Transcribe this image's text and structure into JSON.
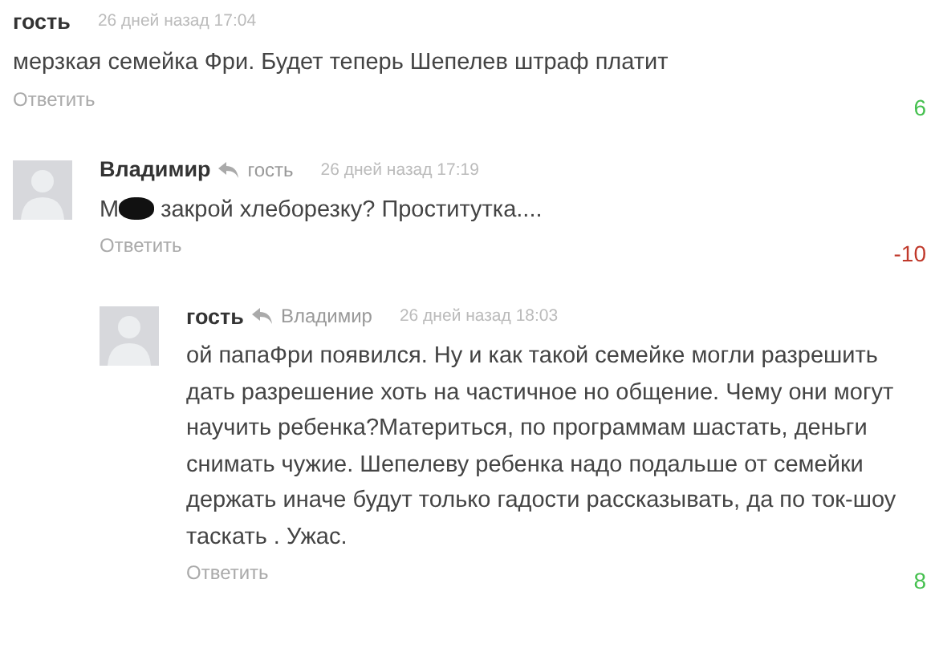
{
  "comments": [
    {
      "author": "гость",
      "time": "26 дней назад 17:04",
      "text_start": "мерзкая семейка Фри. Будет теперь Шепелев штраф платит",
      "reply": "Ответить",
      "score": "6",
      "color": "#45c04f",
      "children": [
        {
          "author": "Владимир",
          "reply_to": "гость",
          "time": "26 дней назад 17:19",
          "has_avatar": true,
          "text_start": "М",
          "redacted": true,
          "text": "закрой хлеборезку? Проститутка....",
          "reply": "Ответить",
          "score": "-10",
          "color": "#c0392b",
          "children": [
            {
              "author": "гость",
              "reply_to": "Владимир",
              "time": "26 дней назад 18:03",
              "has_avatar": true,
              "text_start": "ой папаФри появился. Ну и как такой семейке могли разрешить дать разрешение хоть на частичное но общение. Чему они могут научить ребенка?Материться, по программам шастать, деньги снимать чужие. Шепелеву ребенка надо подальше от семейки держать иначе будут только гадости рассказывать, да по ток-шоу таскать . Ужас.",
              "reply": "Ответить",
              "score": "8",
              "color": "#45c04f"
            }
          ]
        }
      ]
    }
  ]
}
